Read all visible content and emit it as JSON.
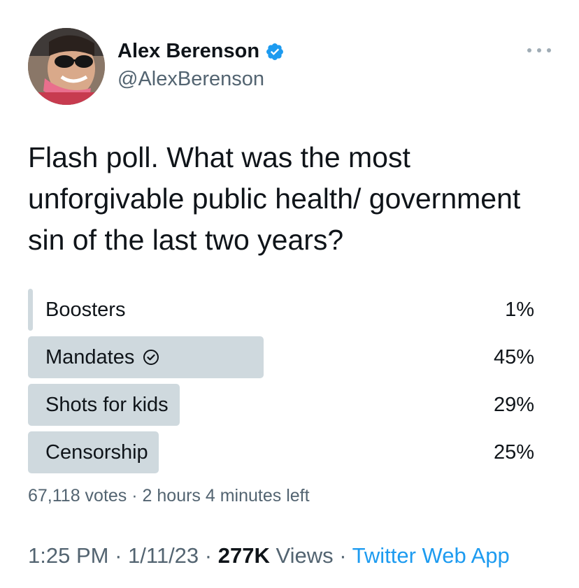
{
  "author": {
    "name": "Alex Berenson",
    "handle": "@AlexBerenson",
    "verified": true,
    "verified_color": "#1d9bf0"
  },
  "tweet": {
    "text": "Flash poll. What was the most unforgivable public health/ government sin of the last two years?"
  },
  "poll": {
    "options": [
      {
        "label": "Boosters",
        "percent_text": "1%",
        "percent": 1,
        "selected": false
      },
      {
        "label": "Mandates",
        "percent_text": "45%",
        "percent": 45,
        "selected": true
      },
      {
        "label": "Shots for kids",
        "percent_text": "29%",
        "percent": 29,
        "selected": false
      },
      {
        "label": "Censorship",
        "percent_text": "25%",
        "percent": 25,
        "selected": false
      }
    ],
    "votes": "67,118 votes",
    "separator": "·",
    "time_left": "2 hours 4 minutes left",
    "bar_color": "#cfd9de"
  },
  "meta": {
    "time": "1:25 PM",
    "date": "1/11/23",
    "views_count": "277K",
    "views_label": "Views",
    "source": "Twitter Web App",
    "separator": "·"
  },
  "icons": {
    "verified": "verified-badge-icon",
    "more": "more-horizontal-icon",
    "selected": "check-circle-icon"
  },
  "colors": {
    "accent": "#1d9bf0",
    "secondary_text": "#536471",
    "primary_text": "#0f1419"
  }
}
